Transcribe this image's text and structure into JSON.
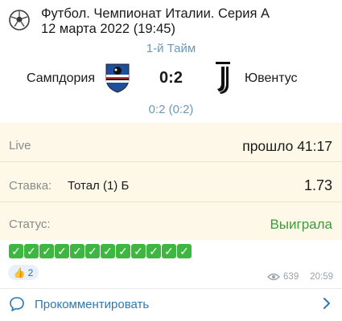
{
  "header": {
    "title": "Футбол. Чемпионат Италии. Серия А",
    "date": "12 марта 2022 (19:45)"
  },
  "match": {
    "period": "1-й Тайм",
    "home_team": "Сампдория",
    "score": "0:2",
    "away_team": "Ювентус",
    "detail_score": "0:2 (0:2)"
  },
  "details": {
    "live_label": "Live",
    "live_value": "прошло 41:17",
    "bet_label": "Ставка:",
    "bet_text": "Тотал (1) Б",
    "odds": "1.73",
    "status_label": "Статус:",
    "status_value": "Выиграла"
  },
  "checks": {
    "count": 12,
    "glyph": "✓"
  },
  "reaction": {
    "icon": "thumbs-up-icon",
    "count": "2"
  },
  "meta": {
    "views": "639",
    "time": "20:59"
  },
  "comment": {
    "label": "Прокомментировать"
  },
  "colors": {
    "accent_blue": "#2c78b4",
    "status_green": "#3f9a3a",
    "panel_bg": "#fdf8e7",
    "check_green": "#3fb641"
  }
}
